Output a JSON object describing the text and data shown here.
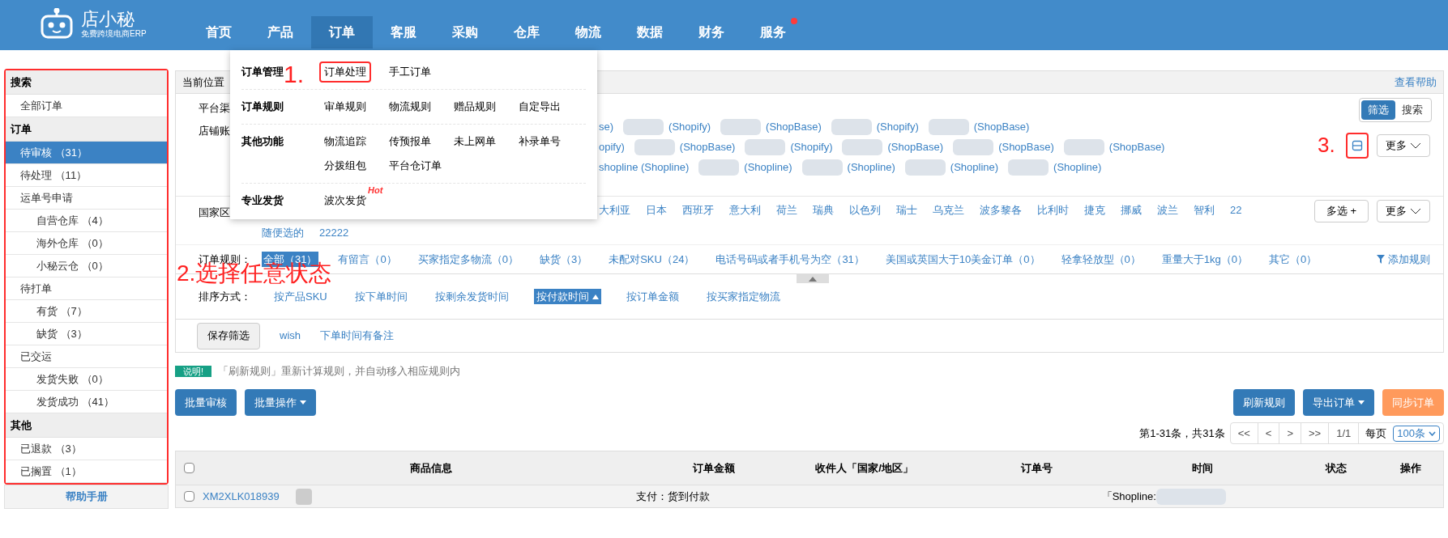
{
  "logo": {
    "name": "店小秘",
    "tagline": "免费跨境电商ERP"
  },
  "nav": [
    {
      "label": "首页",
      "selected": false,
      "dot": false
    },
    {
      "label": "产品",
      "selected": false,
      "dot": false
    },
    {
      "label": "订单",
      "selected": true,
      "dot": false
    },
    {
      "label": "客服",
      "selected": false,
      "dot": false
    },
    {
      "label": "采购",
      "selected": false,
      "dot": false
    },
    {
      "label": "仓库",
      "selected": false,
      "dot": false
    },
    {
      "label": "物流",
      "selected": false,
      "dot": false
    },
    {
      "label": "数据",
      "selected": false,
      "dot": false
    },
    {
      "label": "财务",
      "selected": false,
      "dot": false
    },
    {
      "label": "服务",
      "selected": false,
      "dot": true
    }
  ],
  "menu": [
    {
      "title": "订单管理",
      "items": [
        {
          "label": "订单处理",
          "annotated": true
        },
        {
          "label": "手工订单",
          "annotated": false
        }
      ]
    },
    {
      "title": "订单规则",
      "items": [
        {
          "label": "审单规则",
          "annotated": false
        },
        {
          "label": "物流规则",
          "annotated": false
        },
        {
          "label": "赠品规则",
          "annotated": false
        },
        {
          "label": "自定导出",
          "annotated": false
        }
      ]
    },
    {
      "title": "其他功能",
      "items": [
        {
          "label": "物流追踪",
          "annotated": false
        },
        {
          "label": "传预报单",
          "annotated": false
        },
        {
          "label": "未上网单",
          "annotated": false
        },
        {
          "label": "补录单号",
          "annotated": false
        },
        {
          "label": "分拨组包",
          "annotated": false
        },
        {
          "label": "平台仓订单",
          "annotated": false
        }
      ]
    },
    {
      "title": "专业发货",
      "items": [
        {
          "label": "波次发货",
          "annotated": false,
          "badge": "Hot"
        }
      ]
    }
  ],
  "sidebar": {
    "sections": [
      {
        "title": "搜索",
        "items": [
          {
            "label": "全部订单",
            "selected": false
          }
        ]
      },
      {
        "title": "订单",
        "items": [
          {
            "label": "待审核 （31）",
            "selected": true
          },
          {
            "label": "待处理 （11）",
            "selected": false
          },
          {
            "label": "运单号申请",
            "selected": false,
            "children": [
              {
                "label": "自营仓库 （4）",
                "selected": false
              },
              {
                "label": "海外仓库 （0）",
                "selected": false
              },
              {
                "label": "小秘云仓 （0）",
                "selected": false
              }
            ]
          },
          {
            "label": "待打单",
            "selected": false,
            "children": [
              {
                "label": "有货 （7）",
                "selected": false
              },
              {
                "label": "缺货 （3）",
                "selected": false
              }
            ]
          },
          {
            "label": "已交运",
            "selected": false,
            "children": [
              {
                "label": "发货失败 （0）",
                "selected": false
              },
              {
                "label": "发货成功 （41）",
                "selected": false
              }
            ]
          }
        ]
      },
      {
        "title": "其他",
        "items": [
          {
            "label": "已退款 （3）",
            "selected": false
          },
          {
            "label": "已搁置 （1）",
            "selected": false
          }
        ]
      }
    ],
    "help": "帮助手册"
  },
  "breadcrumb": {
    "label": "当前位置",
    "help": "查看帮助"
  },
  "filters": {
    "platform_label": "平台渠",
    "store_label": "店铺账",
    "view_toggle": [
      {
        "label": "筛选",
        "selected": true
      },
      {
        "label": "搜索",
        "selected": false
      }
    ],
    "store_more": "更多",
    "stores": [
      [
        {
          "text": "se)",
          "redacted": false
        },
        {
          "text": "(Shopify)",
          "redacted": true
        },
        {
          "text": "(ShopBase)",
          "redacted": true
        },
        {
          "text": "(Shopify)",
          "redacted": true
        },
        {
          "text": "(ShopBase)",
          "redacted": true
        }
      ],
      [
        {
          "text": "opify)",
          "redacted": false
        },
        {
          "text": "(ShopBase)",
          "redacted": true
        },
        {
          "text": "(Shopify)",
          "redacted": true
        },
        {
          "text": "(ShopBase)",
          "redacted": true
        },
        {
          "text": "(ShopBase)",
          "redacted": true
        },
        {
          "text": "(ShopBase)",
          "redacted": true
        }
      ],
      [
        {
          "text": "shopline (Shopline)",
          "redacted": false
        },
        {
          "text": "(Shopline)",
          "redacted": true
        },
        {
          "text": "(Shopline)",
          "redacted": true
        },
        {
          "text": "(Shopline)",
          "redacted": true
        },
        {
          "text": "(Shopline)",
          "redacted": true
        }
      ]
    ],
    "country_label": "国家区",
    "countries": [
      [
        "大利亚",
        "日本",
        "西班牙",
        "意大利",
        "荷兰",
        "瑞典",
        "以色列",
        "瑞士",
        "乌克兰",
        "波多黎各",
        "比利时",
        "捷克",
        "挪威",
        "波兰",
        "智利",
        "22"
      ],
      [
        "随便选的",
        "22222"
      ]
    ],
    "multi_select": "多选 +",
    "country_more": "更多",
    "rules_label": "订单规则：",
    "rules": [
      {
        "label": "全部（31）",
        "selected": true
      },
      {
        "label": "有留言（0）",
        "selected": false
      },
      {
        "label": "买家指定多物流（0）",
        "selected": false
      },
      {
        "label": "缺货（3）",
        "selected": false
      },
      {
        "label": "未配对SKU（24）",
        "selected": false
      },
      {
        "label": "电话号码或者手机号为空（31）",
        "selected": false
      },
      {
        "label": "美国或英国大于10美金订单（0）",
        "selected": false
      },
      {
        "label": "轻拿轻放型（0）",
        "selected": false
      },
      {
        "label": "重量大于1kg（0）",
        "selected": false
      },
      {
        "label": "其它（0）",
        "selected": false
      }
    ],
    "add_rule": "添加规则",
    "sort_label": "排序方式：",
    "sorts": [
      {
        "label": "按产品SKU",
        "selected": false
      },
      {
        "label": "按下单时间",
        "selected": false
      },
      {
        "label": "按剩余发货时间",
        "selected": false
      },
      {
        "label": "按付款时间",
        "selected": true
      },
      {
        "label": "按订单金额",
        "selected": false
      },
      {
        "label": "按买家指定物流",
        "selected": false
      }
    ],
    "save_button": "保存筛选",
    "saved": [
      "wish",
      "下单时间有备注"
    ]
  },
  "notice": {
    "tag": "说明!",
    "text": "「刷新规则」重新计算规则，并自动移入相应规则内"
  },
  "actions_left": [
    {
      "label": "批量审核",
      "caret": false
    },
    {
      "label": "批量操作",
      "caret": true
    }
  ],
  "actions_right": [
    {
      "label": "刷新规则",
      "caret": false,
      "kind": "primary"
    },
    {
      "label": "导出订单",
      "caret": true,
      "kind": "primary"
    },
    {
      "label": "同步订单",
      "caret": false,
      "kind": "warning"
    }
  ],
  "pagination": {
    "summary": "第1-31条，共31条",
    "buttons": [
      "<<",
      "<",
      ">",
      ">>",
      "1/1"
    ],
    "per_page_label": "每页",
    "per_page": "100条"
  },
  "table": {
    "select_all_checked": false,
    "columns": [
      "商品信息",
      "订单金额",
      "收件人「国家/地区」",
      "订单号",
      "时间",
      "状态",
      "操作"
    ],
    "rows": [
      {
        "checked": false,
        "order_id": "XM2XLK018939",
        "payment": "支付：货到付款",
        "store": "「Shopline:"
      }
    ]
  },
  "annotations": [
    "1.",
    "2.选择任意状态",
    "3."
  ]
}
